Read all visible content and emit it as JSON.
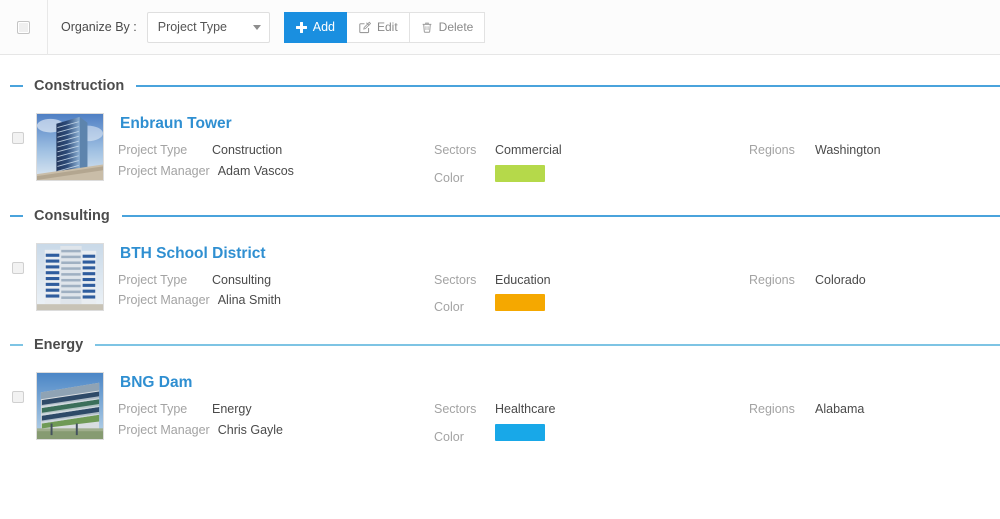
{
  "toolbar": {
    "select_all_checkbox": "unchecked",
    "organize_label": "Organize By :",
    "organize_value": "Project Type",
    "organize_options": [
      "Project Type"
    ],
    "buttons": [
      {
        "label": "Add",
        "icon": "plus-icon",
        "primary": true
      },
      {
        "label": "Edit",
        "icon": "edit-square-icon",
        "primary": false
      },
      {
        "label": "Delete",
        "icon": "trash-icon",
        "primary": false
      }
    ]
  },
  "labels": {
    "project_type": "Project Type",
    "project_manager": "Project Manager",
    "sectors": "Sectors",
    "color": "Color",
    "regions": "Regions"
  },
  "colors": {
    "accent_blue": "#1a8fe0",
    "link_blue": "#2f8fd1",
    "rule_blue": "#4aa3dc",
    "rule_blue_light": "#7ec4e4"
  },
  "sections": [
    {
      "title": "Construction",
      "projects": [
        {
          "name": "Enbraun Tower",
          "thumbnail": "blue-glass-highrise-photo",
          "project_type": "Construction",
          "project_manager": "Adam Vascos",
          "sector": "Commercial",
          "color": "#b5d94a",
          "region": "Washington"
        }
      ]
    },
    {
      "title": "Consulting",
      "projects": [
        {
          "name": "BTH School District",
          "thumbnail": "curved-striped-tower-photo",
          "project_type": "Consulting",
          "project_manager": "Alina Smith",
          "sector": "Education",
          "color": "#f5a800",
          "region": "Colorado"
        }
      ]
    },
    {
      "title": "Energy",
      "projects": [
        {
          "name": "BNG Dam",
          "thumbnail": "modern-lowrise-building-photo",
          "project_type": "Energy",
          "project_manager": "Chris Gayle",
          "sector": "Healthcare",
          "color": "#18a8e8",
          "region": "Alabama"
        }
      ]
    }
  ]
}
